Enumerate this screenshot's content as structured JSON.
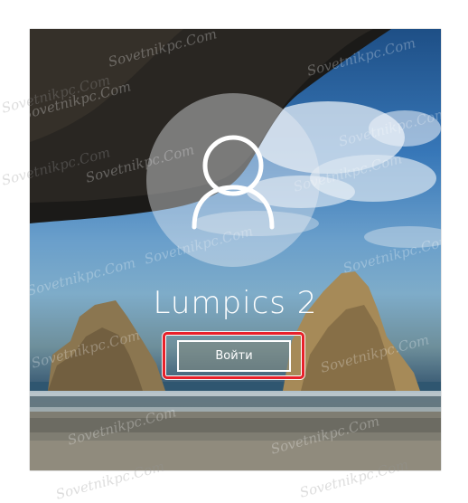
{
  "login": {
    "username": "Lumpics 2",
    "signin_label": "Войти"
  },
  "watermark": {
    "text": "Sovetnikpc.Com"
  },
  "icons": {
    "avatar": "user-silhouette-icon"
  },
  "colors": {
    "highlight": "#e8202a",
    "text": "#ffffff"
  }
}
